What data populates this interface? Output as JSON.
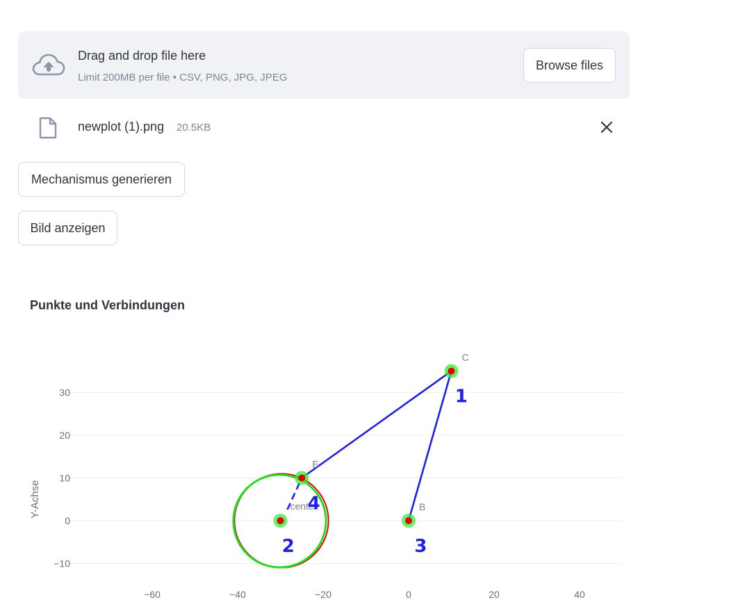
{
  "uploader": {
    "title": "Drag and drop file here",
    "subtitle": "Limit 200MB per file • CSV, PNG, JPG, JPEG",
    "browse_label": "Browse files",
    "icon": "cloud-upload-icon"
  },
  "file": {
    "name": "newplot (1).png",
    "size": "20.5KB",
    "icon": "file-icon",
    "remove_icon": "close-icon"
  },
  "buttons": {
    "generate_label": "Mechanismus generieren",
    "show_label": "Bild anzeigen"
  },
  "chart_data": {
    "type": "scatter",
    "title": "Punkte und Verbindungen",
    "xlabel": "",
    "ylabel": "Y-Achse",
    "xlim": [
      -78,
      50
    ],
    "ylim": [
      -13,
      38
    ],
    "x_ticks": [
      -60,
      -40,
      -20,
      0,
      20,
      40
    ],
    "x_tick_labels": [
      "−60",
      "−40",
      "−20",
      "0",
      "20",
      "40"
    ],
    "y_ticks": [
      -10,
      0,
      10,
      20,
      30
    ],
    "y_tick_labels": [
      "−10",
      "0",
      "10",
      "20",
      "30"
    ],
    "grid": "horizontal",
    "points": [
      {
        "label": "C",
        "x": 10,
        "y": 35
      },
      {
        "label": "E",
        "x": -25,
        "y": 10
      },
      {
        "label": "B",
        "x": 0,
        "y": 0
      },
      {
        "label": "center",
        "x": -30,
        "y": 0
      }
    ],
    "connections": [
      {
        "from": "C",
        "to": "E",
        "style": "solid"
      },
      {
        "from": "C",
        "to": "B",
        "style": "solid"
      },
      {
        "from": "center",
        "to": "E",
        "style": "dashed"
      }
    ],
    "circle": {
      "center_x": -30,
      "center_y": 0,
      "radius": 11
    },
    "link_numbers": [
      {
        "text": "1",
        "x": 12,
        "y": 30
      },
      {
        "text": "4",
        "x": -22.5,
        "y": 5
      },
      {
        "text": "2",
        "x": -28.5,
        "y": -5
      },
      {
        "text": "3",
        "x": 2.5,
        "y": -5
      }
    ],
    "colors": {
      "link": "#1f1fe6",
      "joint_outer": "#33ee33",
      "joint_inner": "#e60000",
      "circle_green": "#22dd22",
      "circle_red": "#e60000",
      "grid": "#ebedf0",
      "tick_text": "#6c6f78",
      "point_label": "#7d8089"
    }
  }
}
